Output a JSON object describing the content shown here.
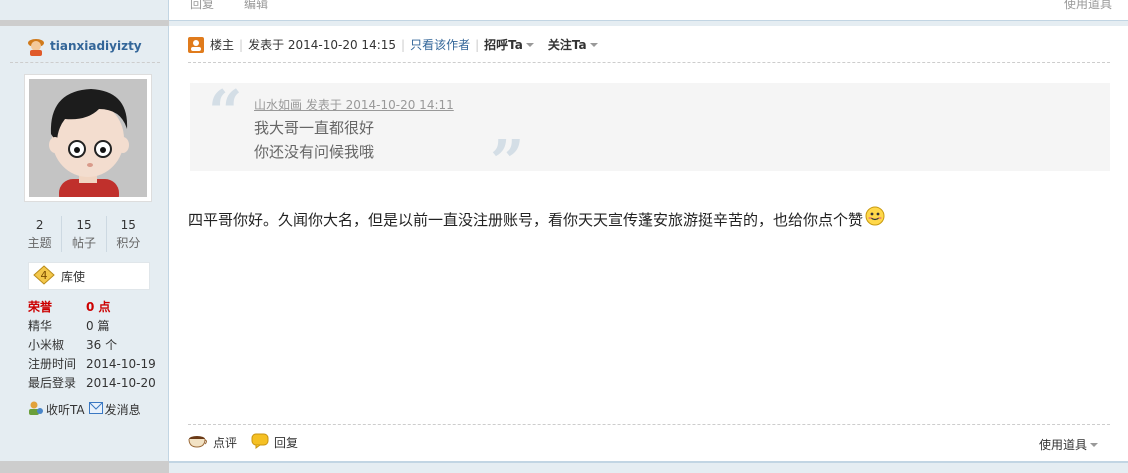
{
  "top": {
    "reply_label": "回复",
    "edit_label": "编辑",
    "tools_label": "使用道具"
  },
  "author": {
    "name": "tianxiadiyizty",
    "stats": [
      {
        "num": "2",
        "label": "主题"
      },
      {
        "num": "15",
        "label": "帖子"
      },
      {
        "num": "15",
        "label": "积分"
      }
    ],
    "rank_level": "4",
    "rank_name": "库使",
    "info": [
      {
        "key": "荣誉",
        "value": "0 点"
      },
      {
        "key": "精华",
        "value": "0 篇"
      },
      {
        "key": "小米椒",
        "value": "36 个"
      },
      {
        "key": "注册时间",
        "value": "2014-10-19"
      },
      {
        "key": "最后登录",
        "value": "2014-10-20"
      }
    ],
    "follow_label": "收听TA",
    "message_label": "发消息"
  },
  "post": {
    "floor_label": "楼主",
    "posted_at": "发表于 2014-10-20 14:15",
    "only_author_label": "只看该作者",
    "greet_label": "招呼Ta",
    "follow_label": "关注Ta",
    "quote": {
      "meta": "山水如画 发表于 2014-10-20 14:11",
      "line1": "我大哥一直都很好",
      "line2": "你还没有问候我哦"
    },
    "body": "四平哥你好。久闻你大名，但是以前一直没注册账号，看你天天宣传蓬安旅游挺辛苦的，也给你点个赞",
    "comment_label": "点评",
    "reply_label": "回复",
    "tools_label": "使用道具"
  },
  "colors": {
    "sidebar_bg": "#e5edf2",
    "border": "#c2d5e3",
    "link": "#336699",
    "honor": "#cc0000"
  }
}
